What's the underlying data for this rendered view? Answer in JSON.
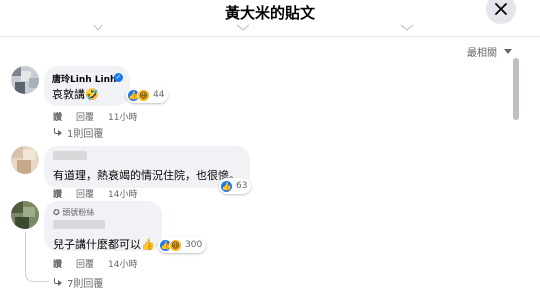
{
  "header": {
    "title": "黃大米的貼文",
    "close_icon": "close-icon"
  },
  "sort": {
    "label": "最相關"
  },
  "comments": [
    {
      "author": "唐玲Linh Linh",
      "verified": true,
      "text": "哀敦講🤣",
      "reactions": [
        "like",
        "haha"
      ],
      "count": "44",
      "actions": [
        "讚",
        "回覆",
        "11小時"
      ],
      "replies": "1則回覆"
    },
    {
      "author": "",
      "text": "有道理，熱衰竭的情況住院，也很慘。",
      "reactions": [
        "like"
      ],
      "count": "63",
      "actions": [
        "讚",
        "回覆",
        "14小時"
      ]
    },
    {
      "author": "",
      "tag": "頭號粉絲",
      "text": "兒子講什麼都可以👍",
      "reactions": [
        "like",
        "haha"
      ],
      "count": "300",
      "actions": [
        "讚",
        "回覆",
        "14小時"
      ],
      "replies": "7則回覆"
    }
  ],
  "colors": {
    "accent": "#1877f2",
    "bubble": "#f0f2f5",
    "muted": "#65676b"
  }
}
